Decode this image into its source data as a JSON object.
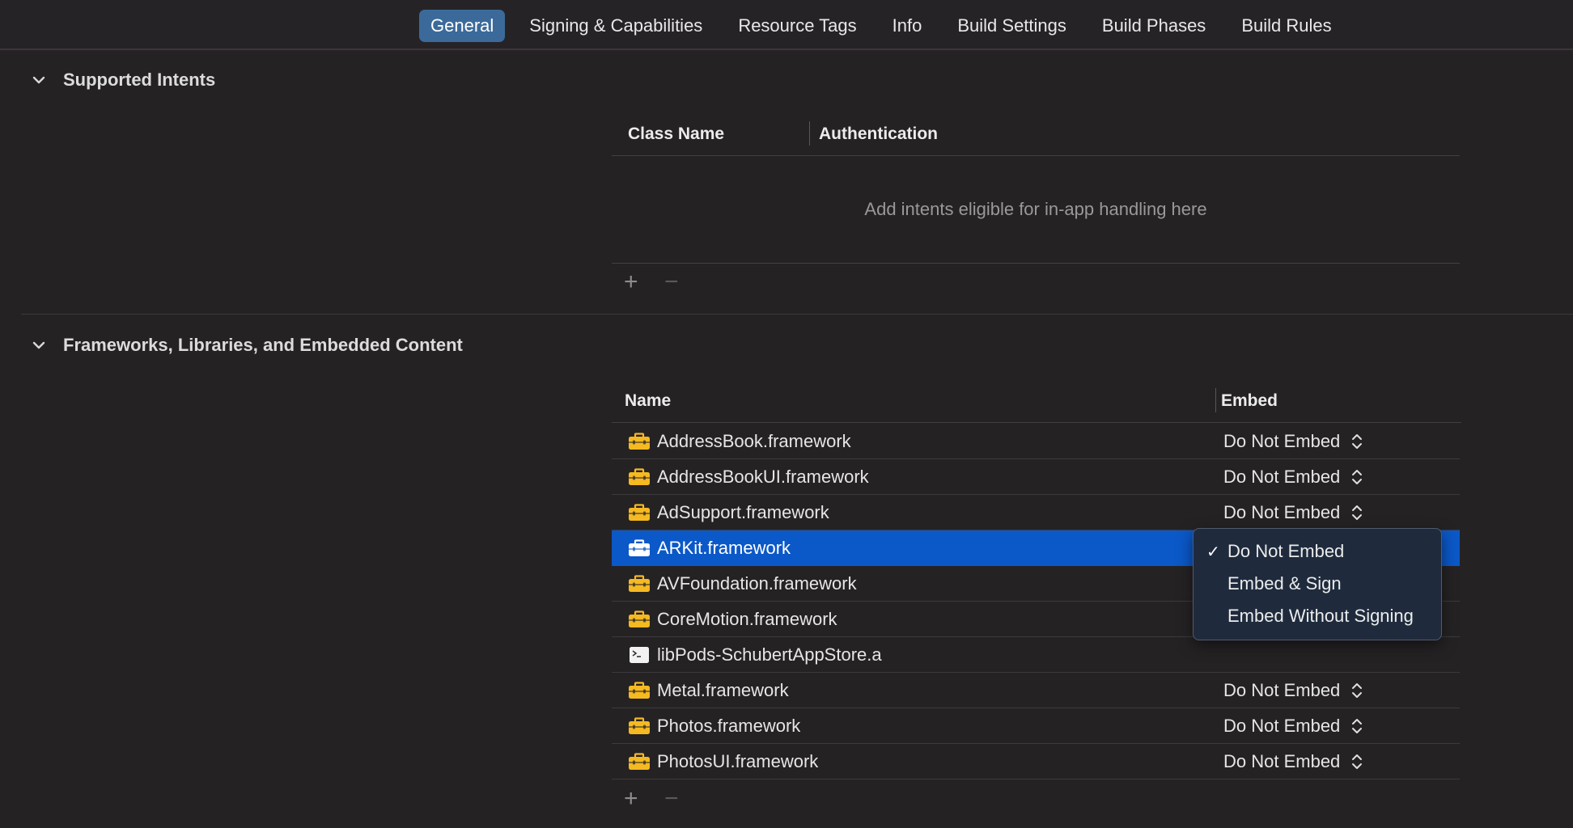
{
  "tabs": [
    "General",
    "Signing & Capabilities",
    "Resource Tags",
    "Info",
    "Build Settings",
    "Build Phases",
    "Build Rules"
  ],
  "active_tab": "General",
  "intents": {
    "title": "Supported Intents",
    "col_class": "Class Name",
    "col_auth": "Authentication",
    "placeholder": "Add intents eligible for in-app handling here",
    "add": "+",
    "remove": "−"
  },
  "frameworks": {
    "title": "Frameworks, Libraries, and Embedded Content",
    "col_name": "Name",
    "col_embed": "Embed",
    "add": "+",
    "remove": "−",
    "rows": [
      {
        "name": "AddressBook.framework",
        "icon": "toolbox-icon",
        "embed": "Do Not Embed"
      },
      {
        "name": "AddressBookUI.framework",
        "icon": "toolbox-icon",
        "embed": "Do Not Embed"
      },
      {
        "name": "AdSupport.framework",
        "icon": "toolbox-icon",
        "embed": "Do Not Embed"
      },
      {
        "name": "ARKit.framework",
        "icon": "toolbox-icon",
        "embed": "",
        "selected": true
      },
      {
        "name": "AVFoundation.framework",
        "icon": "toolbox-icon",
        "embed": ""
      },
      {
        "name": "CoreMotion.framework",
        "icon": "toolbox-icon",
        "embed": ""
      },
      {
        "name": "libPods-SchubertAppStore.a",
        "icon": "terminal-icon",
        "embed": ""
      },
      {
        "name": "Metal.framework",
        "icon": "toolbox-icon",
        "embed": "Do Not Embed"
      },
      {
        "name": "Photos.framework",
        "icon": "toolbox-icon",
        "embed": "Do Not Embed"
      },
      {
        "name": "PhotosUI.framework",
        "icon": "toolbox-icon",
        "embed": "Do Not Embed"
      }
    ]
  },
  "embed_menu": {
    "options": [
      "Do Not Embed",
      "Embed & Sign",
      "Embed Without Signing"
    ],
    "checked": "Do Not Embed",
    "check_mark": "✓"
  },
  "colors": {
    "background": "#252224",
    "selection": "#0b58c8",
    "active_tab": "#3b6a9a",
    "framework_icon": "#f5b921",
    "menu_background": "#1f2b3d"
  }
}
